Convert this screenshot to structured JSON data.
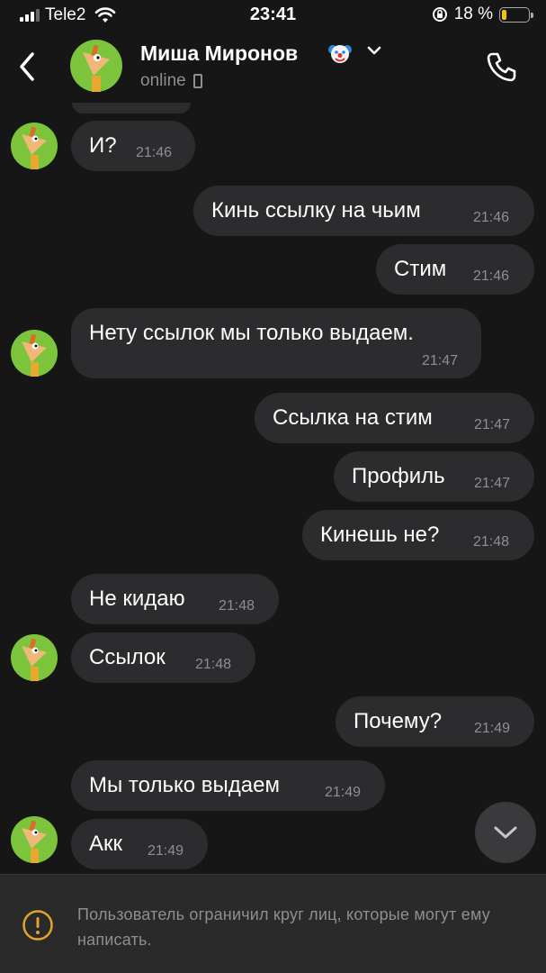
{
  "status_bar": {
    "carrier": "Tele2",
    "time": "23:41",
    "battery_percent": "18 %",
    "battery_level": 0.18,
    "battery_color": "#f5c400"
  },
  "header": {
    "contact_name": "Миша Миронов",
    "status": "online",
    "icons": [
      "back-arrow-icon",
      "clown-emoji-icon",
      "chevron-down-icon",
      "phone-icon"
    ]
  },
  "messages": [
    {
      "side": "in",
      "text": "И?",
      "time": "21:46"
    },
    {
      "side": "out",
      "text": "Кинь ссылку на чьим",
      "time": "21:46"
    },
    {
      "side": "out",
      "text": "Стим",
      "time": "21:46"
    },
    {
      "side": "in",
      "text": "Нету ссылок мы только выдаем.",
      "time": "21:47"
    },
    {
      "side": "out",
      "text": "Ссылка на стим",
      "time": "21:47"
    },
    {
      "side": "out",
      "text": "Профиль",
      "time": "21:47"
    },
    {
      "side": "out",
      "text": "Кинешь не?",
      "time": "21:48"
    },
    {
      "side": "in",
      "text": "Не кидаю",
      "time": "21:48"
    },
    {
      "side": "in",
      "text": "Ссылок",
      "time": "21:48"
    },
    {
      "side": "out",
      "text": "Почему?",
      "time": "21:49"
    },
    {
      "side": "in",
      "text": "Мы только выдаем",
      "time": "21:49"
    },
    {
      "side": "in",
      "text": "Акк",
      "time": "21:49"
    }
  ],
  "footer": {
    "notice": "Пользователь ограничил круг лиц, которые могут ему написать."
  },
  "colors": {
    "background": "#161616",
    "bubble": "#2c2c2e",
    "muted_text": "#8e8e93",
    "footer_bg": "#2a2a2a",
    "avatar_bg": "#7cc43c",
    "warning": "#e0a526"
  }
}
